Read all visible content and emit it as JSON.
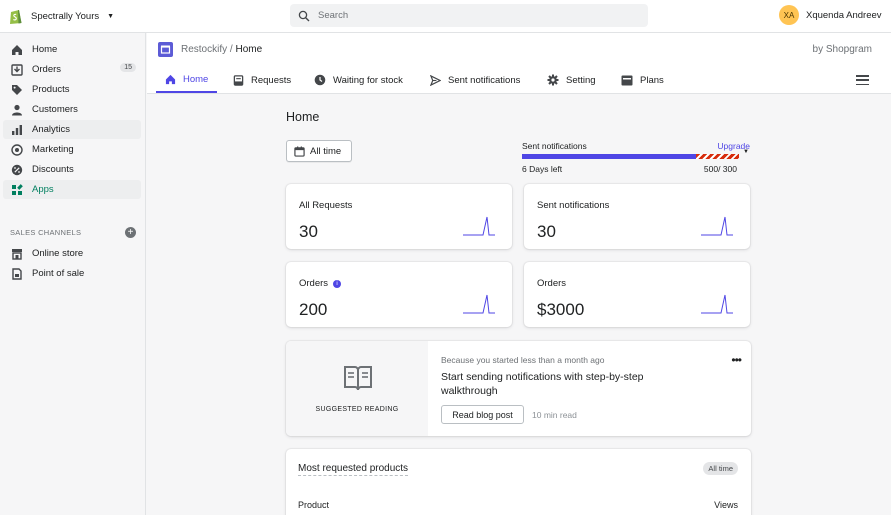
{
  "topbar": {
    "store_name": "Spectrally Yours",
    "search_placeholder": "Search",
    "user_initials": "XA",
    "user_name": "Xquenda Andreev"
  },
  "sidebar": {
    "items": [
      {
        "label": "Home",
        "icon": "home-icon"
      },
      {
        "label": "Orders",
        "icon": "orders-icon",
        "badge": "15"
      },
      {
        "label": "Products",
        "icon": "tag-icon"
      },
      {
        "label": "Customers",
        "icon": "person-icon"
      },
      {
        "label": "Analytics",
        "icon": "bar-chart-icon"
      },
      {
        "label": "Marketing",
        "icon": "target-icon"
      },
      {
        "label": "Discounts",
        "icon": "discount-icon"
      },
      {
        "label": "Apps",
        "icon": "apps-icon"
      }
    ],
    "sales_channels_label": "SALES CHANNELS",
    "channels": [
      {
        "label": "Online store",
        "icon": "store-icon"
      },
      {
        "label": "Point of sale",
        "icon": "pos-icon"
      }
    ]
  },
  "app": {
    "name": "Restockify",
    "separator": " / ",
    "current_page": "Home",
    "by": "by Shopgram",
    "tabs": [
      {
        "label": "Home",
        "icon": "home-icon"
      },
      {
        "label": "Requests",
        "icon": "inbox-icon"
      },
      {
        "label": "Waiting for stock",
        "icon": "clock-icon"
      },
      {
        "label": "Sent notifications",
        "icon": "send-icon"
      },
      {
        "label": "Setting",
        "icon": "gear-icon"
      },
      {
        "label": "Plans",
        "icon": "card-icon"
      }
    ]
  },
  "page": {
    "title": "Home",
    "date_filter": "All time"
  },
  "usage": {
    "label": "Sent notifications",
    "upgrade": "Upgrade",
    "days_left": "6 Days left",
    "count_text": "500/ 300",
    "fill_fraction": 0.8
  },
  "stats": [
    {
      "label": "All Requests",
      "value": "30"
    },
    {
      "label": "Sent notifications",
      "value": "30"
    },
    {
      "label": "Orders",
      "value": "200",
      "info": true
    },
    {
      "label": "Orders",
      "value": "$3000"
    }
  ],
  "suggested": {
    "caption": "SUGGESTED READING",
    "meta": "Because you started less than a month ago",
    "title": "Start sending notifications with step-by-step walkthrough",
    "button": "Read blog post",
    "read_time": "10 min read"
  },
  "most_requested": {
    "title": "Most requested products",
    "badge": "All time",
    "col_product": "Product",
    "col_views": "Views"
  },
  "colors": {
    "accent": "#4f46e5",
    "shopify_green": "#007f5f",
    "avatar": "#ffc453",
    "warning_stripe": "#d72c0d"
  }
}
